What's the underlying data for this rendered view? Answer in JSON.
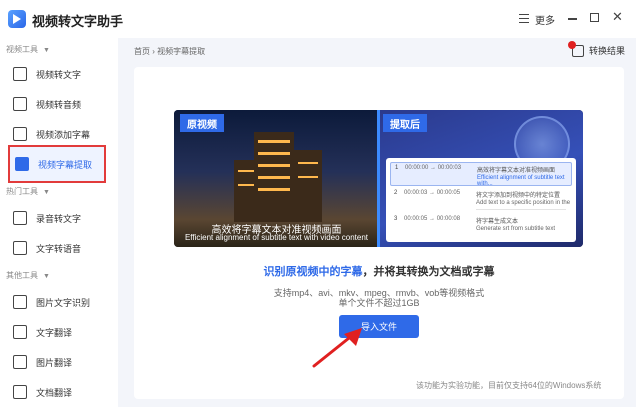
{
  "app": {
    "title": "视频转文字助手",
    "more_label": "更多"
  },
  "sidebar": {
    "sections": [
      {
        "label": "视频工具",
        "items": [
          {
            "label": "视频转文字",
            "icon": "video-text-icon"
          },
          {
            "label": "视频转音频",
            "icon": "video-audio-icon"
          },
          {
            "label": "视频添加字幕",
            "icon": "video-subtitle-icon"
          },
          {
            "label": "视频字幕提取",
            "icon": "subtitle-extract-icon",
            "active": true
          }
        ]
      },
      {
        "label": "热门工具",
        "items": [
          {
            "label": "录音转文字",
            "icon": "microphone-icon"
          },
          {
            "label": "文字转语音",
            "icon": "text-to-speech-icon"
          }
        ]
      },
      {
        "label": "其他工具",
        "items": [
          {
            "label": "图片文字识别",
            "icon": "image-ocr-icon"
          },
          {
            "label": "文字翻译",
            "icon": "text-translate-icon"
          },
          {
            "label": "图片翻译",
            "icon": "image-translate-icon"
          },
          {
            "label": "文档翻译",
            "icon": "document-translate-icon"
          }
        ]
      }
    ]
  },
  "main": {
    "breadcrumb": "首页 › 视频字幕提取",
    "convert_result_label": "转换结果",
    "banner": {
      "original_tag": "原视频",
      "after_tag": "提取后",
      "subtitle_cn": "高效将字幕文本对准视频画面",
      "subtitle_en": "Efficient alignment of subtitle text with video content",
      "rows": [
        {
          "index": "1",
          "time": "00:00:00  →  00:00:03",
          "text_cn": "高效将字幕文本对准视频画面",
          "text_en": "Efficient alignment of subtitle text with..."
        },
        {
          "index": "2",
          "time": "00:00:03  →  00:00:05",
          "text_cn": "将文字添加到视频中的特定位置",
          "text_en": "Add text to a specific position in the ..."
        },
        {
          "index": "3",
          "time": "00:00:05  →  00:00:08",
          "text_cn": "将字幕生成文本",
          "text_en": "Generate srt from subtitle text"
        }
      ]
    },
    "desc_highlight": "识别原视频中的字幕",
    "desc_rest": "，并将其转换为文档或字幕",
    "formats": "支持mp4、avi、mkv、mpeg、rmvb、vob等视频格式",
    "size_limit": "单个文件不超过1GB",
    "import_button": "导入文件",
    "footnote": "该功能为实验功能，目前仅支持64位的Windows系统",
    "accent_color": "#2f6ae8",
    "arrow_color": "#e02020"
  }
}
